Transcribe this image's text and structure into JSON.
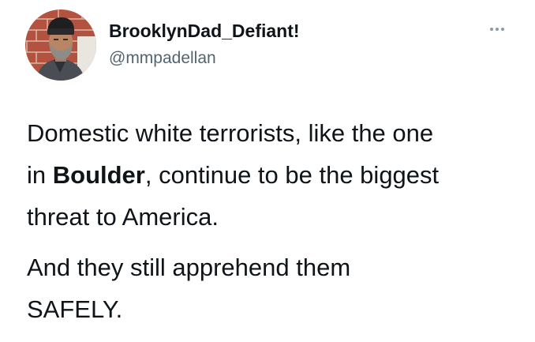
{
  "user": {
    "display_name": "BrooklynDad_Defiant!",
    "handle": "@mmpadellan",
    "avatar_icon": "profile-photo"
  },
  "more_icon": "ellipsis-icon",
  "tweet": {
    "line1": "Domestic white terrorists, like the one",
    "line2_before": "in ",
    "line2_bold": "Boulder",
    "line2_after": ", continue to be the biggest",
    "line3": "threat to America.",
    "para2_line1": "And they still apprehend them",
    "para2_line2": "SAFELY."
  },
  "colors": {
    "text": "#0f1419",
    "secondary": "#536471",
    "background": "#ffffff"
  }
}
